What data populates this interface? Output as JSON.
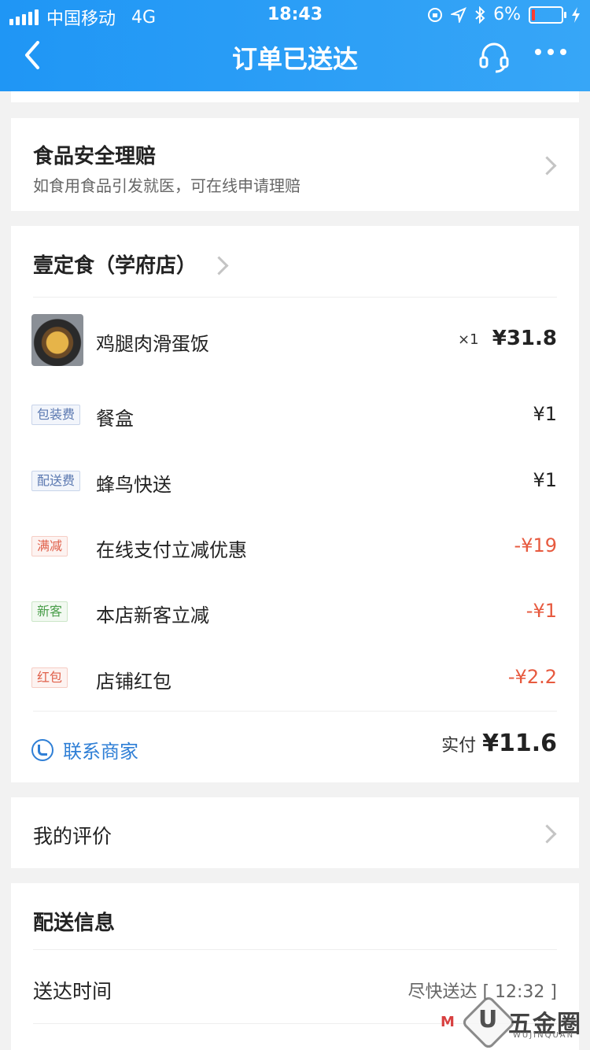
{
  "status_bar": {
    "carrier": "中国移动",
    "network": "4G",
    "time": "18:43",
    "battery": "6%"
  },
  "header": {
    "title": "订单已送达"
  },
  "food_safety": {
    "title": "食品安全理赔",
    "subtitle": "如食用食品引发就医，可在线申请理赔"
  },
  "order": {
    "store_name": "壹定食（学府店）",
    "item": {
      "name": "鸡腿肉滑蛋饭",
      "qty": "×1",
      "price": "¥31.8"
    },
    "fees": [
      {
        "tag": "包装费",
        "tag_color": "blue",
        "name": "餐盒",
        "amount": "¥1"
      },
      {
        "tag": "配送费",
        "tag_color": "blue",
        "name": "蜂鸟快送",
        "amount": "¥1"
      },
      {
        "tag": "满减",
        "tag_color": "red",
        "name": "在线支付立减优惠",
        "amount": "-¥19"
      },
      {
        "tag": "新客",
        "tag_color": "green",
        "name": "本店新客立减",
        "amount": "-¥1"
      },
      {
        "tag": "红包",
        "tag_color": "red",
        "name": "店铺红包",
        "amount": "-¥2.2"
      }
    ],
    "contact_label": "联系商家",
    "paid_label": "实付",
    "paid_amount": "¥11.6"
  },
  "review": {
    "title": "我的评价"
  },
  "delivery": {
    "title": "配送信息",
    "time_label": "送达时间",
    "time_value": "尽快送达 [ 12:32 ]"
  },
  "watermark": {
    "text": "五金圈",
    "small": "WUJINQUAN"
  },
  "colors": {
    "header_blue": "#2d9ef6",
    "discount_red": "#e75a3f",
    "link_blue": "#2f7fd6"
  }
}
